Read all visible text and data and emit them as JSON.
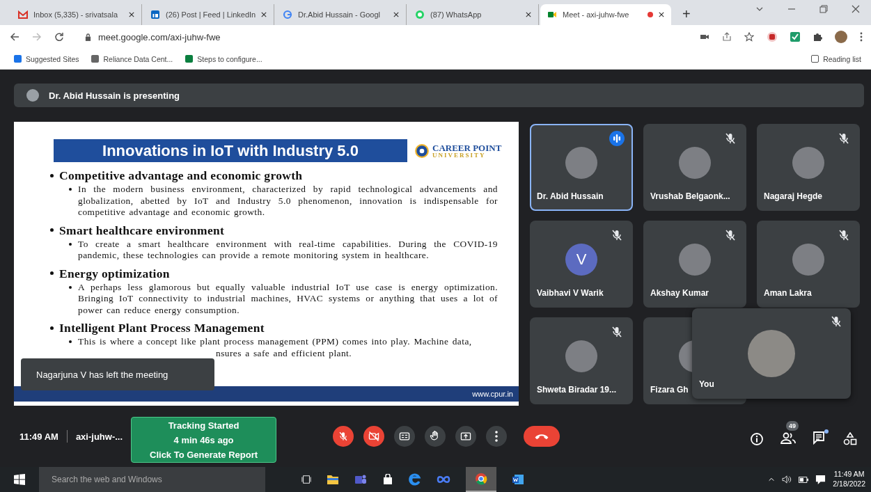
{
  "browser": {
    "tabs": [
      {
        "kind": "mail",
        "title": "Inbox (5,335) - srivatsala",
        "selected": false,
        "recording": false
      },
      {
        "kind": "linkedin",
        "title": "(26) Post | Feed | LinkedIn",
        "selected": false,
        "recording": false
      },
      {
        "kind": "google",
        "title": "Dr.Abid Hussain - Googl",
        "selected": false,
        "recording": false
      },
      {
        "kind": "whatsapp",
        "title": "(87) WhatsApp",
        "selected": false,
        "recording": false
      },
      {
        "kind": "meet",
        "title": "Meet - axi-juhw-fwe",
        "selected": true,
        "recording": true
      }
    ],
    "new_tab": "+",
    "url": "meet.google.com/axi-juhw-fwe",
    "bookmarks": [
      "Suggested Sites",
      "Reliance Data Cent...",
      "Steps to configure..."
    ],
    "reading_list": "Reading list"
  },
  "meet": {
    "presenting": "Dr. Abid Hussain is presenting",
    "slide": {
      "title": "Innovations in IoT with Industry 5.0",
      "logo_top": "CAREER POINT",
      "logo_bottom": "UNIVERSITY",
      "footer": "www.cpur.in",
      "sections": [
        {
          "heading": "Competitive advantage and economic growth",
          "points": [
            "In the modern business environment, characterized by rapid technological advancements and globalization, abetted by IoT and Industry 5.0 phenomenon, innovation is indispensable for competitive advantage and economic growth."
          ]
        },
        {
          "heading": "Smart healthcare environment",
          "points": [
            "To create a smart healthcare environment with real-time capabilities. During the COVID-19 pandemic, these technologies can provide a remote monitoring system in healthcare."
          ]
        },
        {
          "heading": "Energy optimization",
          "points": [
            "A perhaps less glamorous but equally valuable industrial IoT use case is energy optimization. Bringing IoT connectivity to industrial machines, HVAC systems or anything that uses a lot of power can reduce energy consumption."
          ]
        },
        {
          "heading": "Intelligent Plant Process Management",
          "points": [
            "This is where a concept like plant process management (PPM) comes into play. Machine data,"
          ],
          "trailing_text": "nsures a safe and efficient plant."
        }
      ]
    },
    "toast": "Nagarjuna V has left the meeting",
    "participants": [
      {
        "name": "Dr. Abid Hussain",
        "kind": "photo",
        "speaking": true,
        "muted": false
      },
      {
        "name": "Vrushab Belgaonk...",
        "kind": "photo",
        "speaking": false,
        "muted": true
      },
      {
        "name": "Nagaraj Hegde",
        "kind": "photo",
        "speaking": false,
        "muted": true
      },
      {
        "name": "Vaibhavi V Warik",
        "kind": "letter",
        "initial": "V",
        "color": "#5c6bc0",
        "speaking": false,
        "muted": true
      },
      {
        "name": "Akshay Kumar",
        "kind": "photo",
        "speaking": false,
        "muted": true
      },
      {
        "name": "Aman Lakra",
        "kind": "photo",
        "speaking": false,
        "muted": true
      },
      {
        "name": "Shweta Biradar 19...",
        "kind": "photo",
        "speaking": false,
        "muted": true
      },
      {
        "name": "Fizara Gh",
        "kind": "photo",
        "speaking": false
      }
    ],
    "self_view": {
      "name": "You",
      "muted": true
    },
    "time": "11:49 AM",
    "code": "axi-juhw-...",
    "tracking": [
      "Tracking Started",
      "4 min 46s ago",
      "Click To Generate Report"
    ],
    "mic_on": false,
    "camera_on": false,
    "participant_count": "49",
    "chat_unread": true
  },
  "taskbar": {
    "search_placeholder": "Search the web and Windows",
    "time": "11:49 AM",
    "date": "2/18/2022"
  }
}
